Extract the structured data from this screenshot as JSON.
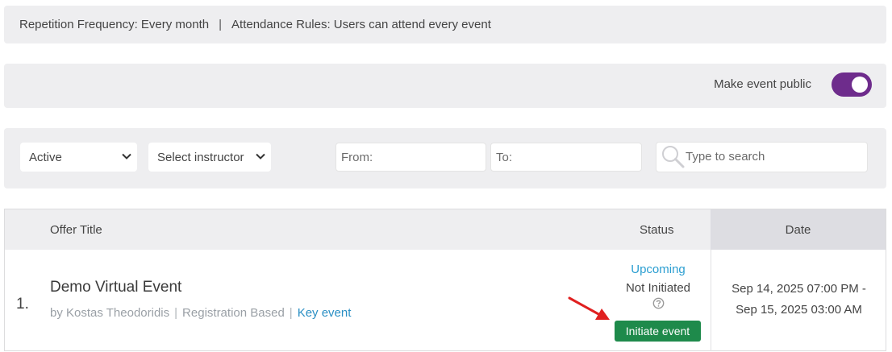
{
  "info_bar": {
    "repetition": "Repetition Frequency: Every month",
    "separator": "|",
    "attendance": "Attendance Rules: Users can attend every event"
  },
  "public_bar": {
    "label": "Make event public",
    "toggle_on": true,
    "toggle_color": "#6e2c8c"
  },
  "filters": {
    "status_select": "Active",
    "instructor_select": "Select instructor",
    "from_placeholder": "From:",
    "to_placeholder": "To:",
    "search_placeholder": "Type to search",
    "icons": {
      "select_chevron": "chevron-down-icon",
      "search": "search-icon"
    }
  },
  "table": {
    "headers": {
      "title": "Offer Title",
      "status": "Status",
      "date": "Date"
    },
    "rows": [
      {
        "index": "1.",
        "title": "Demo Virtual Event",
        "author": "by Kostas Theodoridis",
        "type": "Registration Based",
        "sep": "|",
        "tag": "Key event",
        "status_primary": "Upcoming",
        "status_secondary": "Not Initiated",
        "action": "Initiate event",
        "date_line1": "Sep 14, 2025 07:00 PM -",
        "date_line2": "Sep 15, 2025 03:00 AM"
      }
    ]
  },
  "colors": {
    "accent_purple": "#6e2c8c",
    "link_blue": "#2a8fc4",
    "action_green": "#1e8a4b",
    "annotation_red": "#e02020"
  }
}
